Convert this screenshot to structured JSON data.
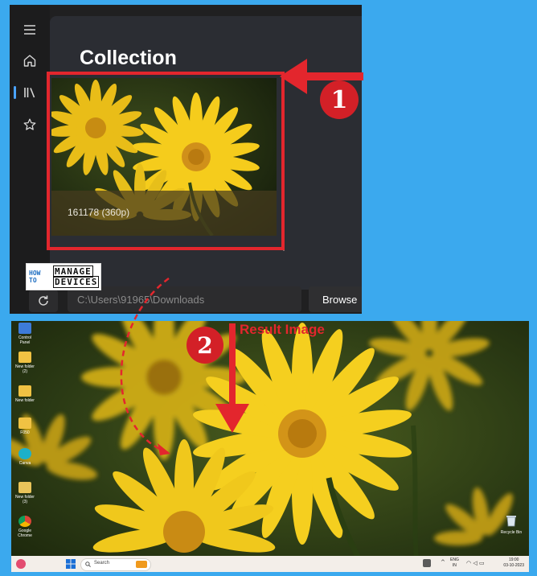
{
  "app": {
    "title": "Collection",
    "nav": {
      "menu_icon": "hamburger-icon",
      "home_icon": "home-icon",
      "library_icon": "library-icon",
      "favorites_icon": "star-icon"
    },
    "thumbnail_caption": "161178 (360p)",
    "path_value": "C:\\Users\\91965\\Downloads",
    "browse_label": "Browse",
    "refresh_icon": "refresh-icon"
  },
  "logo": {
    "how": "HOW",
    "to": "TO",
    "manage": "MANAGE",
    "devices": "DEVICES"
  },
  "callouts": {
    "step1": "1",
    "step2": "2",
    "result_label": "Result Image",
    "accent_color": "#e3262d"
  },
  "desktop": {
    "icons": [
      {
        "label": "Control Panel"
      },
      {
        "label": "New folder (2)"
      },
      {
        "label": "New folder"
      },
      {
        "label": "F050"
      },
      {
        "label": "Canva"
      },
      {
        "label": "New folder (3)"
      },
      {
        "label": "Google Chrome"
      }
    ],
    "recycle_bin_label": "Recycle Bin",
    "taskbar": {
      "search_label": "Search",
      "lang": "ENG",
      "region": "IN",
      "time": "19:00",
      "date": "03-10-2023"
    }
  },
  "colors": {
    "background": "#3ba9ee",
    "app_bg": "#202021",
    "flower_yellow": "#f2c81a",
    "flower_center": "#c98a10"
  }
}
